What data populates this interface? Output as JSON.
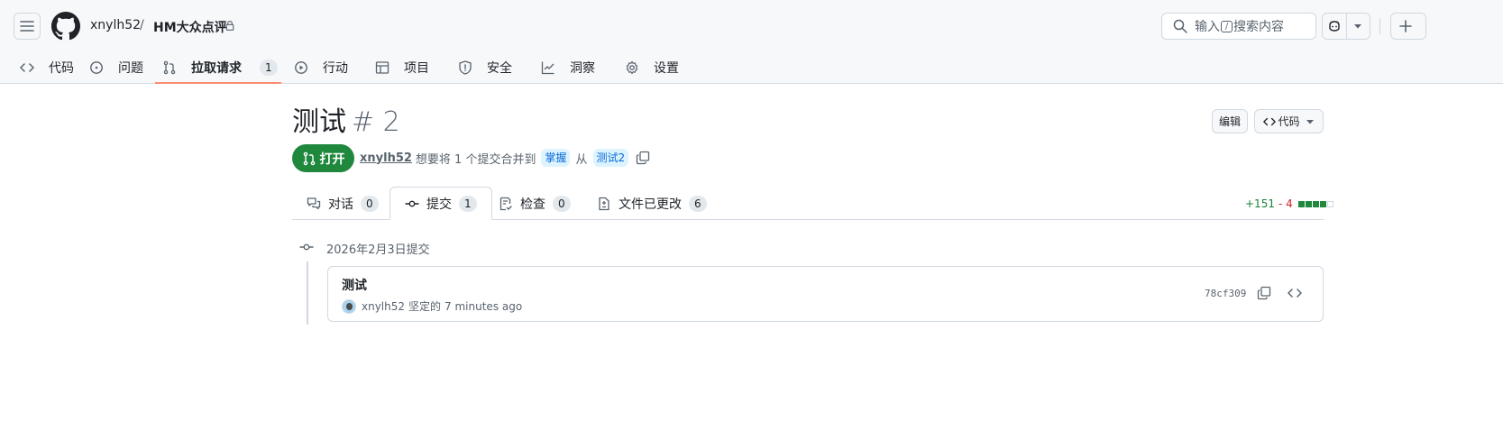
{
  "header": {
    "owner": "xnylh52",
    "separator": "/",
    "repo": "HM大众点评",
    "search": {
      "placeholder_pre": "输入",
      "shortcut": "/",
      "placeholder_post": "搜索内容"
    }
  },
  "nav": {
    "items": [
      {
        "label": "代码",
        "icon": "code-icon"
      },
      {
        "label": "问题",
        "icon": "issue-opened-icon"
      },
      {
        "label": "拉取请求",
        "icon": "git-pull-request-icon",
        "count": "1",
        "active": true
      },
      {
        "label": "行动",
        "icon": "play-icon"
      },
      {
        "label": "项目",
        "icon": "table-icon"
      },
      {
        "label": "安全",
        "icon": "shield-icon"
      },
      {
        "label": "洞察",
        "icon": "graph-icon"
      },
      {
        "label": "设置",
        "icon": "gear-icon"
      }
    ]
  },
  "pr": {
    "title": "测试",
    "number": "# 2",
    "edit_label": "编辑",
    "code_label": "代码",
    "state": "打开",
    "author": "xnylh52",
    "merge_text": "想要将 1 个提交合并到",
    "base_branch": "掌握",
    "from_text": "从",
    "head_branch": "测试2"
  },
  "tabs": [
    {
      "label": "对话",
      "count": "0",
      "icon": "comment-discussion-icon"
    },
    {
      "label": "提交",
      "count": "1",
      "icon": "git-commit-icon",
      "active": true
    },
    {
      "label": "检查",
      "count": "0",
      "icon": "checklist-icon"
    },
    {
      "label": "文件已更改",
      "count": "6",
      "icon": "file-diff-icon"
    }
  ],
  "diffstat": {
    "additions": "+151",
    "deletions": "- 4"
  },
  "commits": {
    "group_date": "2026年2月3日提交",
    "items": [
      {
        "message": "测试",
        "author": "xnylh52",
        "action": "坚定的",
        "time": "7 minutes ago",
        "sha": "78cf309"
      }
    ]
  },
  "colors": {
    "accent_underline": "#fd8c73",
    "open_green": "#1f883d",
    "branch_bg": "#ddf4ff",
    "branch_fg": "#0969da"
  }
}
